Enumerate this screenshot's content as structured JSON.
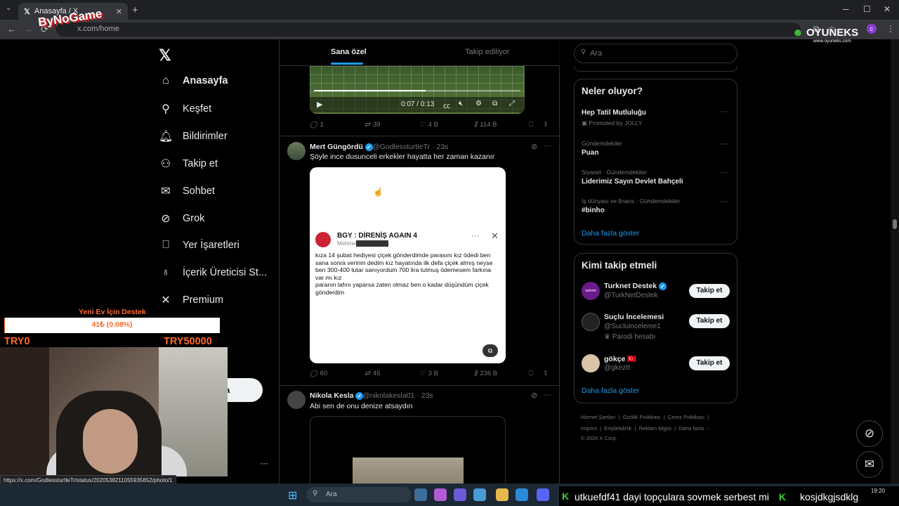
{
  "browser": {
    "tab_title": "Anasayfa / X",
    "new_tab": "+",
    "url": "x.com/home",
    "win_min": "─",
    "win_max": "☐",
    "win_close": "✕",
    "back": "←",
    "forward": "→",
    "reload": "⟳"
  },
  "left_nav": {
    "items": [
      {
        "label": "Anasayfa",
        "icon": "home-icon"
      },
      {
        "label": "Keşfet",
        "icon": "search-icon"
      },
      {
        "label": "Bildirimler",
        "icon": "bell-icon"
      },
      {
        "label": "Takip et",
        "icon": "person-plus-icon"
      },
      {
        "label": "Sohbet",
        "icon": "mail-icon"
      },
      {
        "label": "Grok",
        "icon": "grok-icon"
      },
      {
        "label": "Yer İşaretleri",
        "icon": "bookmark-icon"
      },
      {
        "label": "İçerik Üreticisi St...",
        "icon": "creator-icon"
      },
      {
        "label": "Premium",
        "icon": "x-icon"
      }
    ],
    "post_button_partial": "nla",
    "more_dots": "···"
  },
  "timeline": {
    "tab_for_you": "Sana özel",
    "tab_following": "Takip ediliyor",
    "video": {
      "time": "0:07 / 0:13",
      "progress": 0.54
    },
    "post1_stats": {
      "replies": "1",
      "reposts": "39",
      "likes": "4 B",
      "views": "114 B"
    },
    "post2": {
      "name": "Mert Güngördü",
      "handle": "@GodlessturtleTr · 23s",
      "text": "Şöyle ince dusunceli erkekler hayatta her zaman kazanır",
      "card_name": "BGY : DİRENİŞ AGAIN 4",
      "card_handle": "Mehme",
      "card_text": "kıza 14 şubat hediyesi çiçek gönderdimde parasını kız ödedi ben sana sonra veririm dedim kız hayatında ilk defa çiçek almış neyse ben 300-400 tutar sanıyordum 700 lira tutmuş ödemesem farkına var mı kız\nparanın lafını yaparsa zaten olmaz ben o kadar düşündüm çiçek gönderdim",
      "stats": {
        "replies": "60",
        "reposts": "45",
        "likes": "3 B",
        "views": "236 B"
      }
    },
    "post3": {
      "name": "Nikola Kesla",
      "handle": "@nikolakesla01 · 23s",
      "text": "Abi sen de onu denize atsaydın"
    }
  },
  "right": {
    "search_placeholder": "Ara",
    "trends_title": "Neler oluyor?",
    "trends": [
      {
        "category": "",
        "name": "Hep Tatil Mutluluğu",
        "promo": "Promoted by JOLLY"
      },
      {
        "category": "Gündemdekiler",
        "name": "Puan"
      },
      {
        "category": "Siyaset · Gündemdekiler",
        "name": "Liderimiz Sayın Devlet Bahçeli"
      },
      {
        "category": "İş dünyası ve finans · Gündemdekiler",
        "name": "#binho"
      }
    ],
    "show_more": "Daha fazla göster",
    "who_to_follow_title": "Kimi takip etmeli",
    "follow": [
      {
        "name": "Turknet Destek",
        "handle": "@TurkNetDestek",
        "avatar_text": "turknet",
        "button": "Takip et"
      },
      {
        "name": "Suçlu İncelemesi",
        "handle": "@Sucluinceleme1",
        "note": "Parodi hesabı",
        "button": "Takip et"
      },
      {
        "name": "gökçe 🇹🇷",
        "handle": "@gkeztt",
        "button": "Takip et"
      }
    ],
    "show_more2": "Daha fazla göster",
    "footer": [
      "Hizmet Şartları",
      "Gizlilik Politikası",
      "Çerez Politikası",
      "Imprint",
      "Erişilebilirlik",
      "Reklam bilgisi",
      "Daha fazla ···",
      "© 2026 X Corp."
    ]
  },
  "overlay": {
    "logo": "ByNoGame",
    "oyuneks": "OYUNEKS",
    "oyuneks_url": "www.oyuneks.com",
    "donation_title": "Yeni Ev İçin Destek",
    "donation_amount": "41₺ (0.08%)",
    "donation_progress": 0.0008,
    "donation_min": "TRY0",
    "donation_max": "TRY50000",
    "status_url": "https://x.com/GodlessturtleTr/status/2020538211055935652/photo/1",
    "ticker": "utkuefdf41 dayi topçulara sovmek serbest mi",
    "ticker2": "kosjdkgjsdklg",
    "clock": "19:20"
  },
  "taskbar": {
    "search": "Ara"
  },
  "colors": {
    "accent": "#1d9bf0",
    "donation": "#ff6a2a",
    "ticker_k": "#3ad12d"
  }
}
